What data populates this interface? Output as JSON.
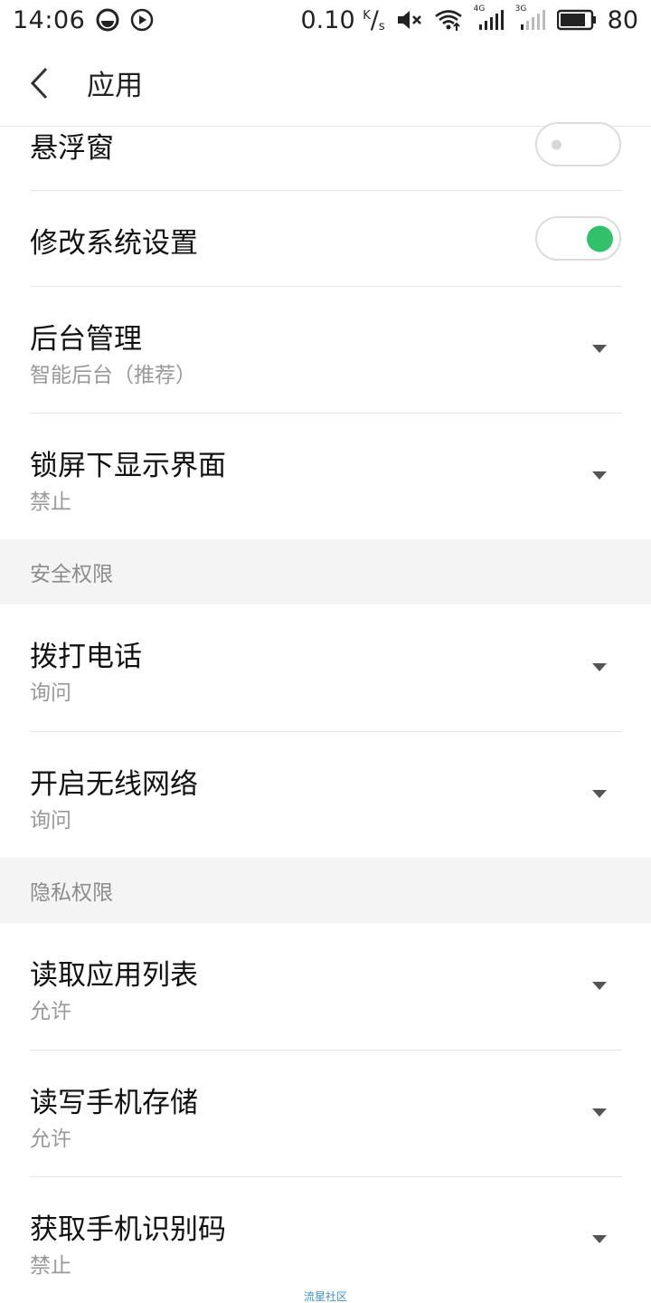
{
  "status_bar": {
    "time": "14:06",
    "speed_value": "0.10",
    "speed_unit_top": "K",
    "speed_unit_bottom": "s",
    "net1": "4G",
    "net2": "3G",
    "battery": "80"
  },
  "app_bar": {
    "title": "应用"
  },
  "rows": {
    "floating_window": {
      "label": "悬浮窗",
      "toggle": "off"
    },
    "modify_settings": {
      "label": "修改系统设置",
      "toggle": "on"
    },
    "background_mgmt": {
      "label": "后台管理",
      "value": "智能后台（推荐）"
    },
    "lockscreen_display": {
      "label": "锁屏下显示界面",
      "value": "禁止"
    }
  },
  "section_security": {
    "title": "安全权限"
  },
  "security": {
    "make_call": {
      "label": "拨打电话",
      "value": "询问"
    },
    "enable_wifi": {
      "label": "开启无线网络",
      "value": "询问"
    }
  },
  "section_privacy": {
    "title": "隐私权限"
  },
  "privacy": {
    "read_app_list": {
      "label": "读取应用列表",
      "value": "允许"
    },
    "rw_storage": {
      "label": "读写手机存储",
      "value": "允许"
    },
    "read_imei": {
      "label": "获取手机识别码",
      "value": "禁止"
    }
  },
  "watermark": "流星社区",
  "colors": {
    "toggle_on": "#32c06a",
    "section_bg": "#f4f4f4",
    "secondary_text": "#999999"
  }
}
